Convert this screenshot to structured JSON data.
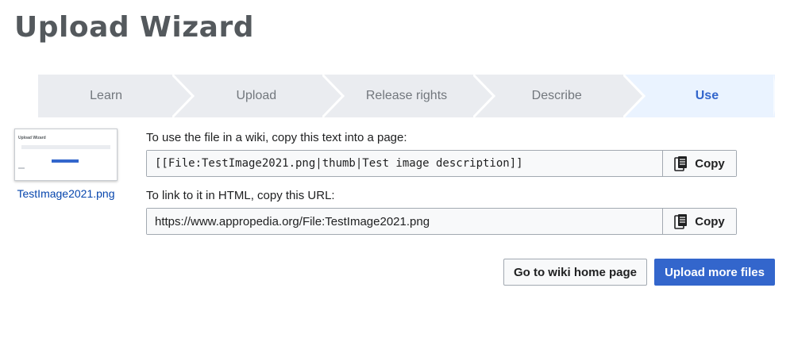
{
  "page": {
    "title": "Upload Wizard"
  },
  "steps": [
    {
      "label": "Learn",
      "active": false
    },
    {
      "label": "Upload",
      "active": false
    },
    {
      "label": "Release rights",
      "active": false
    },
    {
      "label": "Describe",
      "active": false
    },
    {
      "label": "Use",
      "active": true
    }
  ],
  "thumbnail": {
    "filename": "TestImage2021.png",
    "preview_title": "Upload Wizard"
  },
  "wiki_text": {
    "label": "To use the file in a wiki, copy this text into a page:",
    "value": "[[File:TestImage2021.png|thumb|Test image description]]",
    "copy_label": "Copy"
  },
  "html_link": {
    "label": "To link to it in HTML, copy this URL:",
    "value": "https://www.appropedia.org/File:TestImage2021.png",
    "copy_label": "Copy"
  },
  "actions": {
    "home_label": "Go to wiki home page",
    "more_label": "Upload more files"
  },
  "colors": {
    "accent": "#3366cc",
    "link": "#0645ad",
    "step_bg": "#eaecf0",
    "step_active_bg": "#eaf3ff"
  }
}
